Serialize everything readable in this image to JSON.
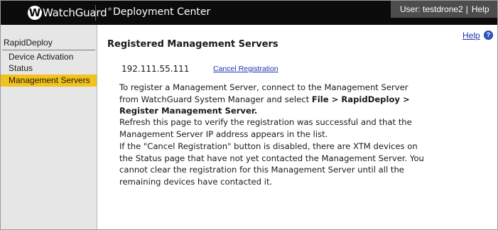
{
  "header": {
    "logo_text": "WatchGuard",
    "app_title": "Deployment Center",
    "user_label": "User: testdrone2",
    "separator": "|",
    "help_label": "Help"
  },
  "sidebar": {
    "section_title": "RapidDeploy",
    "items": [
      {
        "label": "Device Activation",
        "active": false
      },
      {
        "label": "Status",
        "active": false
      },
      {
        "label": "Management Servers",
        "active": true
      }
    ]
  },
  "main": {
    "help_link": "Help",
    "title": "Registered Management Servers",
    "server_ip": "192.111.55.111",
    "cancel_label": "Cancel Registration",
    "para1_text": "To register a Management Server, connect to the Management Server from WatchGuard System Manager and select ",
    "para1_bold": "File > RapidDeploy > Register Management Server.",
    "para2": "Refresh this page to verify the registration was successful and that the Management Server IP address appears in the list.",
    "para3": "If the \"Cancel Registration\" button is disabled, there are XTM devices on the Status page that have not yet contacted the Management Server. You cannot clear the registration for this Management Server until all the remaining devices have contacted it."
  },
  "colors": {
    "header_bg": "#0b0b0b",
    "user_box_bg": "#4d4d4d",
    "sidebar_bg": "#e6e6e6",
    "active_item": "#f3c31c",
    "link": "#1a33b3",
    "help_icon": "#2d57c8"
  },
  "icons": {
    "logo": "watchguard-logo-icon",
    "help": "question-circle-icon"
  }
}
